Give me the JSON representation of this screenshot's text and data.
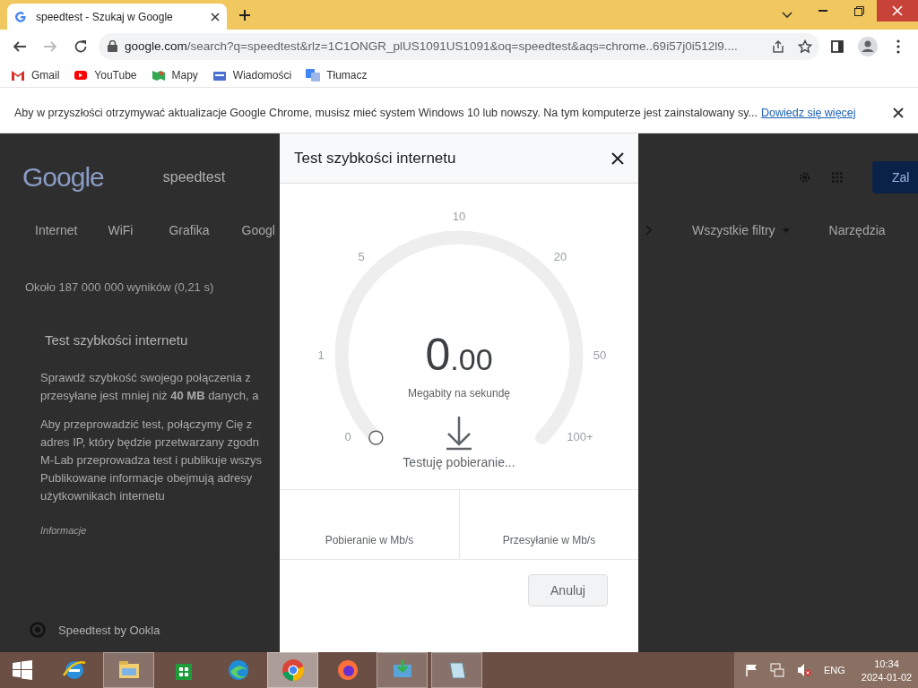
{
  "browser": {
    "tabs": [
      {
        "title": "speedtest - Szukaj w Google",
        "selected": true
      }
    ],
    "address": {
      "host": "google.com",
      "path": "/search?q=speedtest&rlz=1C1ONGR_plUS1091US1091&oq=speedtest&aqs=chrome..69i57j0i512l9...."
    },
    "bookmarks": [
      {
        "label": "Gmail",
        "kind": "gmail"
      },
      {
        "label": "YouTube",
        "kind": "youtube"
      },
      {
        "label": "Mapy",
        "kind": "maps"
      },
      {
        "label": "Wiadomości",
        "kind": "news"
      },
      {
        "label": "Tłumacz",
        "kind": "translate"
      }
    ],
    "infobar": {
      "text": "Aby w przyszłości otrzymywać aktualizacje Google Chrome, musisz mieć system Windows 10 lub nowszy. Na tym komputerze jest zainstalowany sy...",
      "link": "Dowiedz się więcej"
    }
  },
  "page": {
    "logo": "Google",
    "query": "speedtest",
    "nav_left": [
      "Internet",
      "WiFi",
      "Grafika",
      "Googl"
    ],
    "nav_right": [
      {
        "label": "Wszystkie filtry",
        "kind": "dropdown"
      },
      {
        "label": "Narzędzia",
        "kind": "plain"
      }
    ],
    "sign_in": "Zal",
    "results_count": "Około 187 000 000 wyników (0,21 s)",
    "card": {
      "title": "Test szybkości internetu",
      "paragraphs": [
        [
          "Sprawdź szybkość swojego połączenia z",
          "przesyłane jest mniej niż **40 MB** danych, a"
        ],
        [
          "Aby przeprowadzić test, połączymy Cię z",
          "adres IP, który będzie przetwarzany zgodn",
          "M-Lab przeprowadza test i publikuje wszys",
          "Publikowane informacje obejmują adresy",
          "użytkownikach internetu"
        ]
      ],
      "source": "Informacje"
    },
    "result_title": "Speedtest by Ookla"
  },
  "dialog": {
    "title": "Test szybkości internetu",
    "gauge": {
      "ticks": [
        "0",
        "1",
        "5",
        "10",
        "20",
        "50",
        "100+"
      ],
      "value_int": "0",
      "value_dec": ".00",
      "unit": "Megabity na sekundę",
      "status": "Testuję pobieranie..."
    },
    "stats": [
      {
        "label": "Pobieranie w Mb/s"
      },
      {
        "label": "Przesyłanie w Mb/s"
      }
    ],
    "cancel": "Anuluj"
  },
  "taskbar": {
    "apps": [
      {
        "kind": "ie",
        "running": false,
        "selected": false
      },
      {
        "kind": "explorer",
        "running": true,
        "selected": false
      },
      {
        "kind": "store",
        "running": false,
        "selected": false
      },
      {
        "kind": "edge",
        "running": false,
        "selected": false
      },
      {
        "kind": "chrome",
        "running": true,
        "selected": true
      },
      {
        "kind": "firefox",
        "running": false,
        "selected": false
      },
      {
        "kind": "installer",
        "running": true,
        "selected": false
      },
      {
        "kind": "notepad",
        "running": true,
        "selected": false
      }
    ],
    "lang": "ENG",
    "time": "10:34",
    "date": "2024-01-02"
  }
}
